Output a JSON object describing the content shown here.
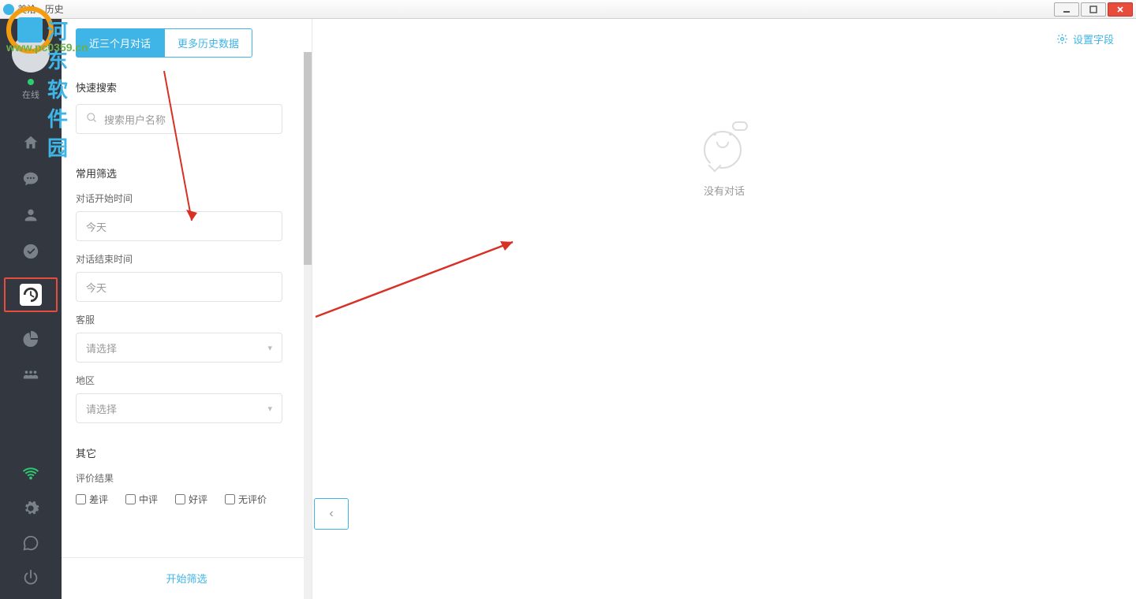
{
  "watermark": {
    "brand": "河东软件园",
    "url": "www.pc0359.cn"
  },
  "titlebar": {
    "title": "美洽 - 历史"
  },
  "sidebar": {
    "status": "在线"
  },
  "tabs": {
    "recent": "近三个月对话",
    "more": "更多历史数据"
  },
  "filter": {
    "quick_search_title": "快速搜索",
    "search_placeholder": "搜索用户名称",
    "common_filter_title": "常用筛选",
    "start_time_label": "对话开始时间",
    "start_time_value": "今天",
    "end_time_label": "对话结束时间",
    "end_time_value": "今天",
    "agent_label": "客服",
    "agent_value": "请选择",
    "region_label": "地区",
    "region_value": "请选择",
    "other_title": "其它",
    "rating_label": "评价结果",
    "ratings": [
      "差评",
      "中评",
      "好评",
      "无评价"
    ],
    "submit": "开始筛选"
  },
  "content": {
    "settings_label": "设置字段",
    "empty_text": "没有对话"
  }
}
